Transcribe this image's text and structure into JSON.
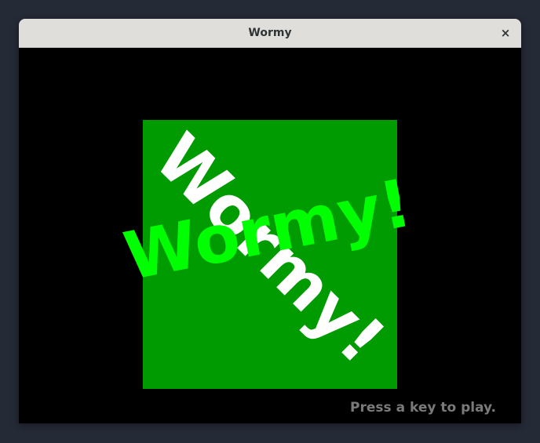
{
  "window": {
    "title": "Wormy",
    "close_label": "×"
  },
  "game": {
    "background_color": "#000000",
    "box_color": "#009b00",
    "title_text_white": "Wormy!",
    "title_text_green": "Wormy!",
    "title_white_color": "#ffffff",
    "title_green_color": "#00ff00",
    "prompt": "Press a key to play."
  }
}
